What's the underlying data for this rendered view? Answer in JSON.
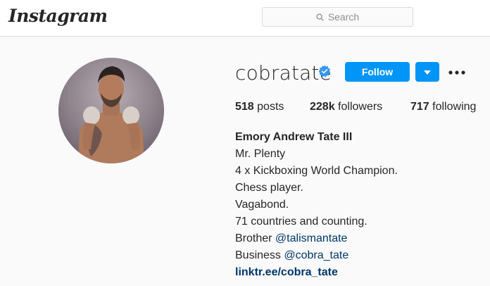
{
  "header": {
    "logo_text": "Instagram",
    "search_placeholder": "Search"
  },
  "profile": {
    "username": "cobratate",
    "verified": true,
    "follow_label": "Follow",
    "stats": {
      "posts_count": "518",
      "posts_label": "posts",
      "followers_count": "228k",
      "followers_label": "followers",
      "following_count": "717",
      "following_label": "following"
    },
    "bio": {
      "full_name": "Emory Andrew Tate III",
      "lines": [
        "Mr. Plenty",
        "4 x Kickboxing World Champion.",
        "Chess player.",
        "Vagabond.",
        "71 countries and counting."
      ],
      "brother_prefix": "Brother",
      "brother_handle": "@talismantate",
      "business_prefix": "Business",
      "business_handle": "@cobra_tate",
      "website": "linktr.ee/cobra_tate"
    }
  },
  "colors": {
    "accent": "#0095f6",
    "link": "#00376b",
    "verified": "#3897f0",
    "text": "#262626",
    "muted": "#8e8e8e",
    "background": "#fafafa"
  }
}
